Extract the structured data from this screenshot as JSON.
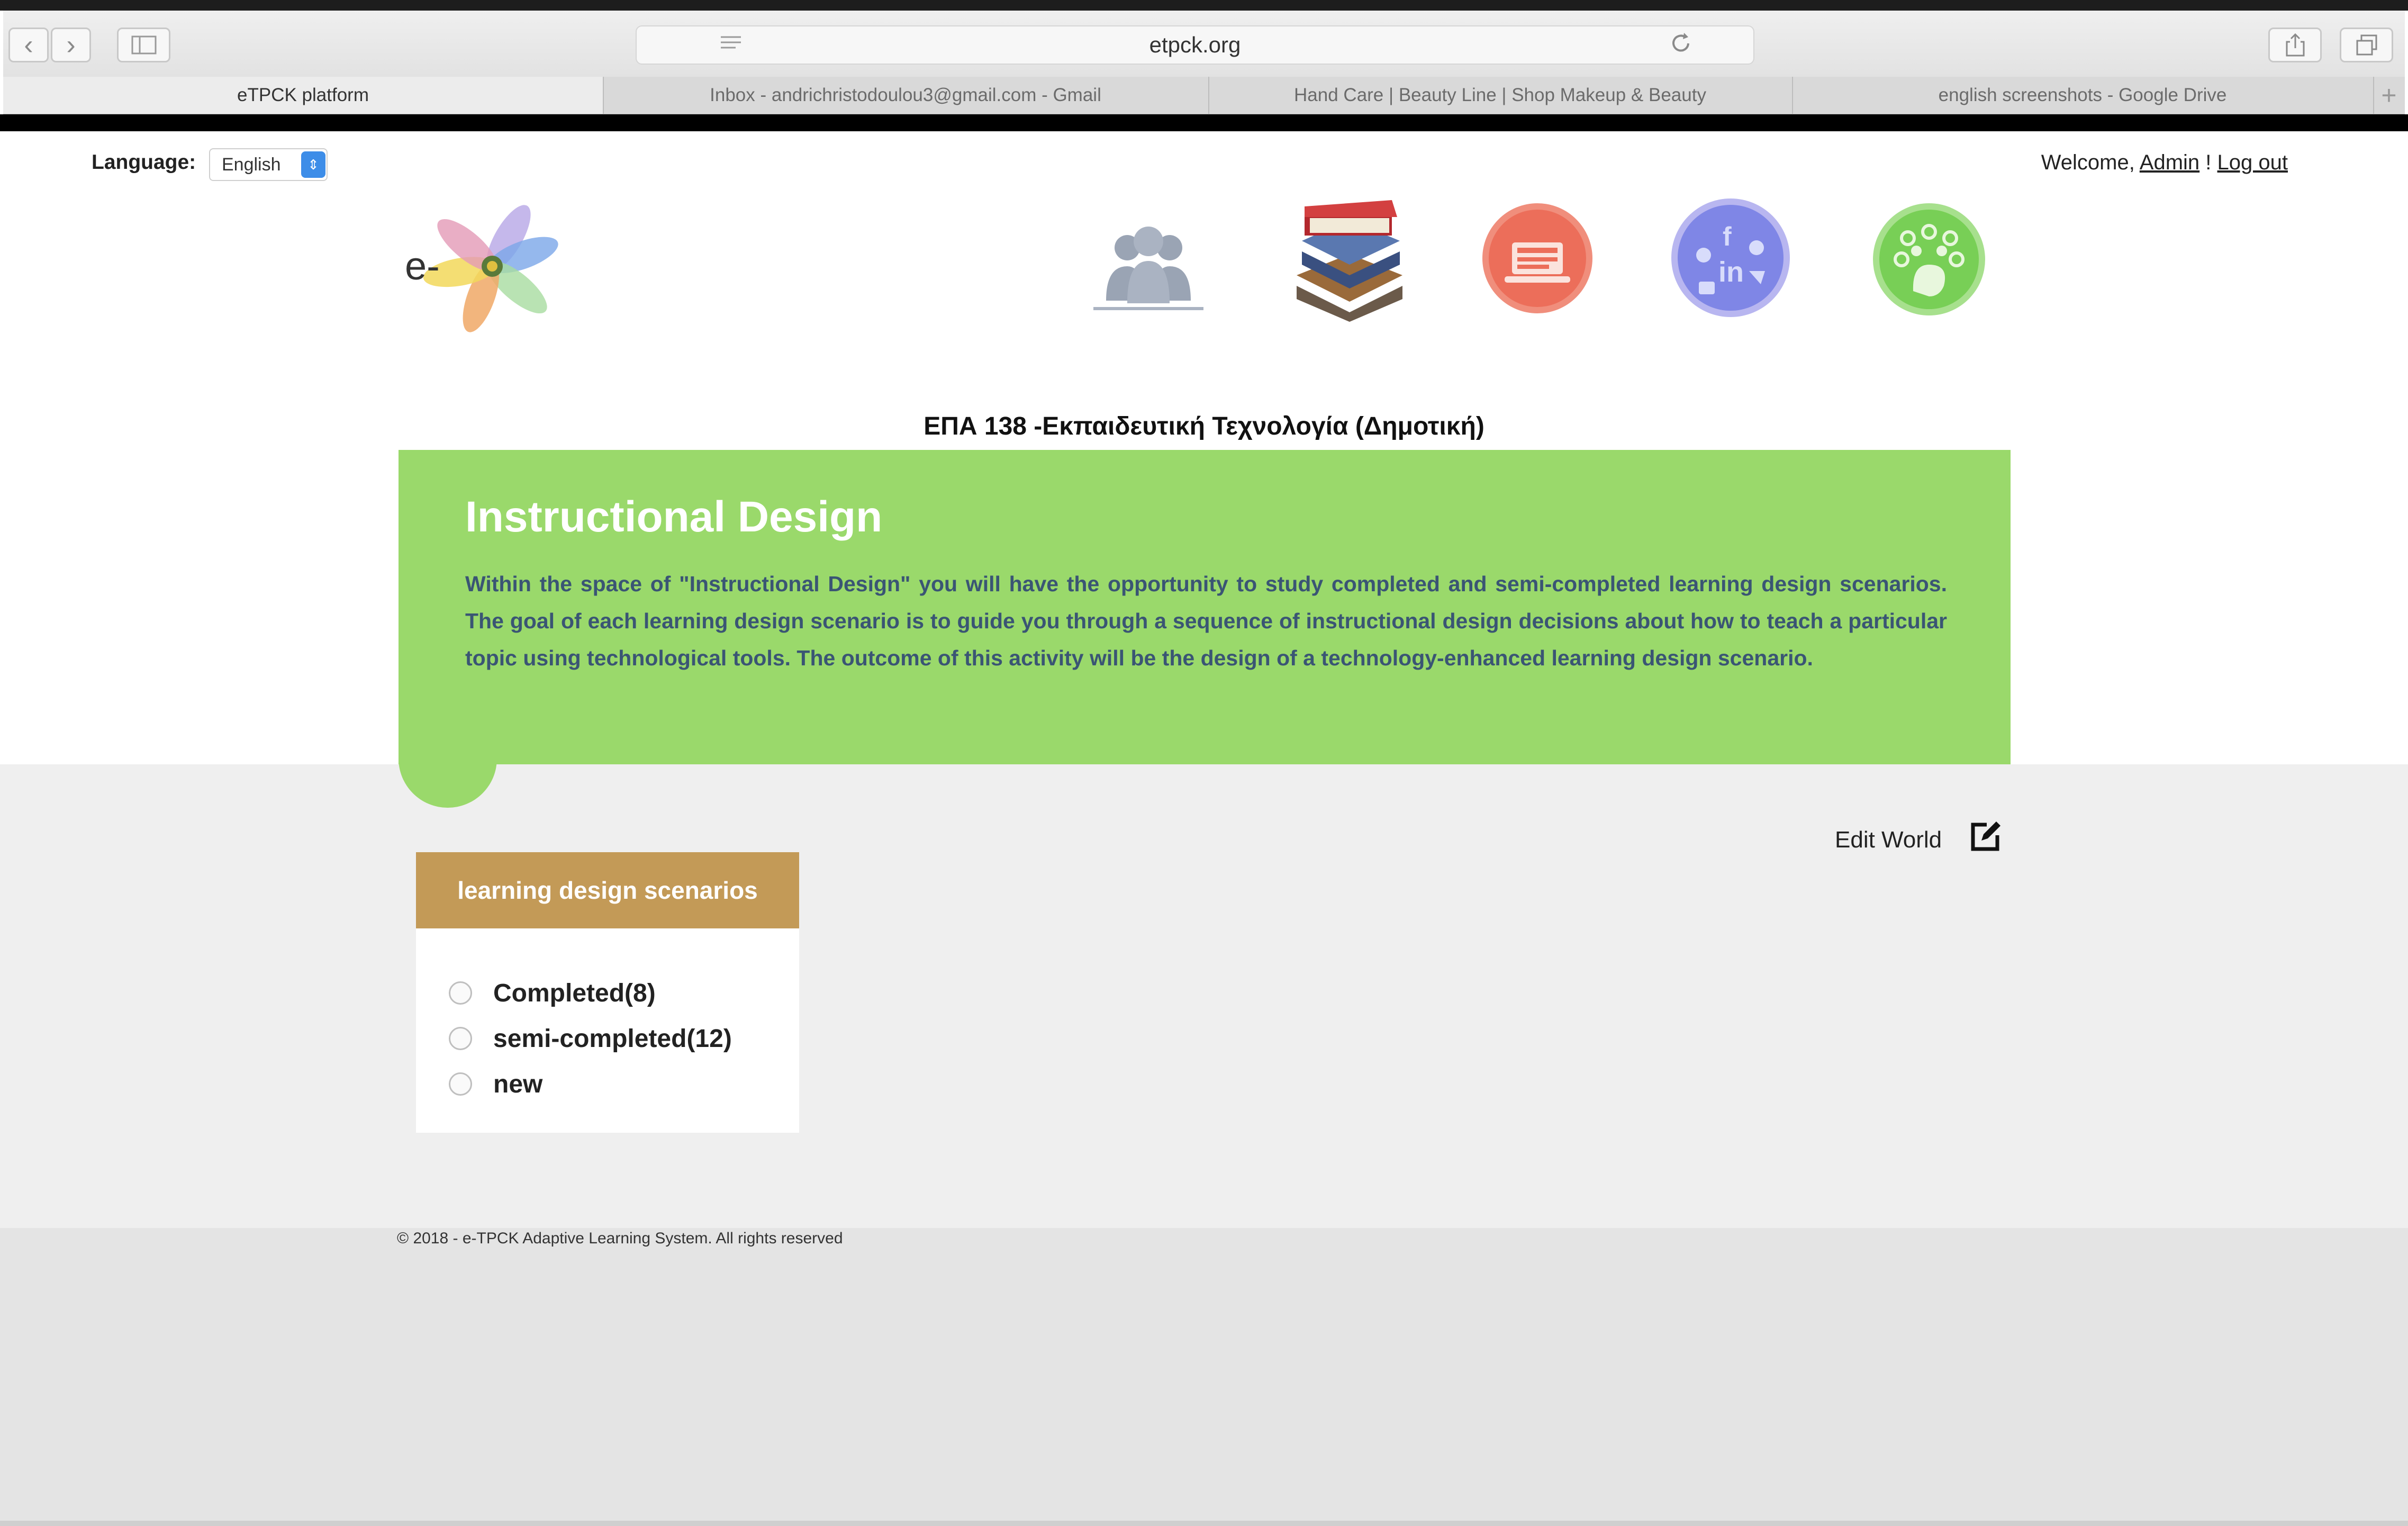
{
  "browser": {
    "url": "etpck.org",
    "tabs": [
      {
        "label": "eTPCK platform",
        "active": true
      },
      {
        "label": "Inbox - andrichristodoulou3@gmail.com - Gmail",
        "active": false
      },
      {
        "label": "Hand Care | Beauty Line | Shop Makeup & Beauty",
        "active": false
      },
      {
        "label": "english screenshots - Google Drive",
        "active": false
      }
    ]
  },
  "header": {
    "language_label": "Language:",
    "language_value": "English",
    "welcome_text": "Welcome,",
    "user_name": "Admin",
    "separator": "!",
    "logout_label": "Log out",
    "logo_text": "e-"
  },
  "nav_icons": [
    "users-icon",
    "books-icon",
    "laptop-reading-icon",
    "social-media-icon",
    "idea-tree-icon"
  ],
  "course_title": "ΕΠΑ 138 -Εκπαιδευτική Τεχνολογία (Δημοτική)",
  "hero": {
    "title": "Instructional Design",
    "text": "Within the space of \"Instructional Design\" you will have the opportunity to study completed and semi-completed learning design scenarios. The goal of each learning design scenario is to guide you through a sequence of instructional design decisions about how to teach a particular topic using technological tools. The outcome of this activity will be the design of a technology-enhanced learning design scenario."
  },
  "edit_world_label": "Edit World",
  "panel": {
    "title": "learning design scenarios",
    "options": [
      "Completed(8)",
      "semi-completed(12)",
      "new"
    ]
  },
  "footer": {
    "copyright": "© 2018 - e-TPCK Adaptive Learning System. All rights reserved"
  },
  "colors": {
    "hero_green": "#9ad96b",
    "panel_header": "#c39a57",
    "hero_text": "#3a5574",
    "language_select_accent": "#3d8de8"
  }
}
